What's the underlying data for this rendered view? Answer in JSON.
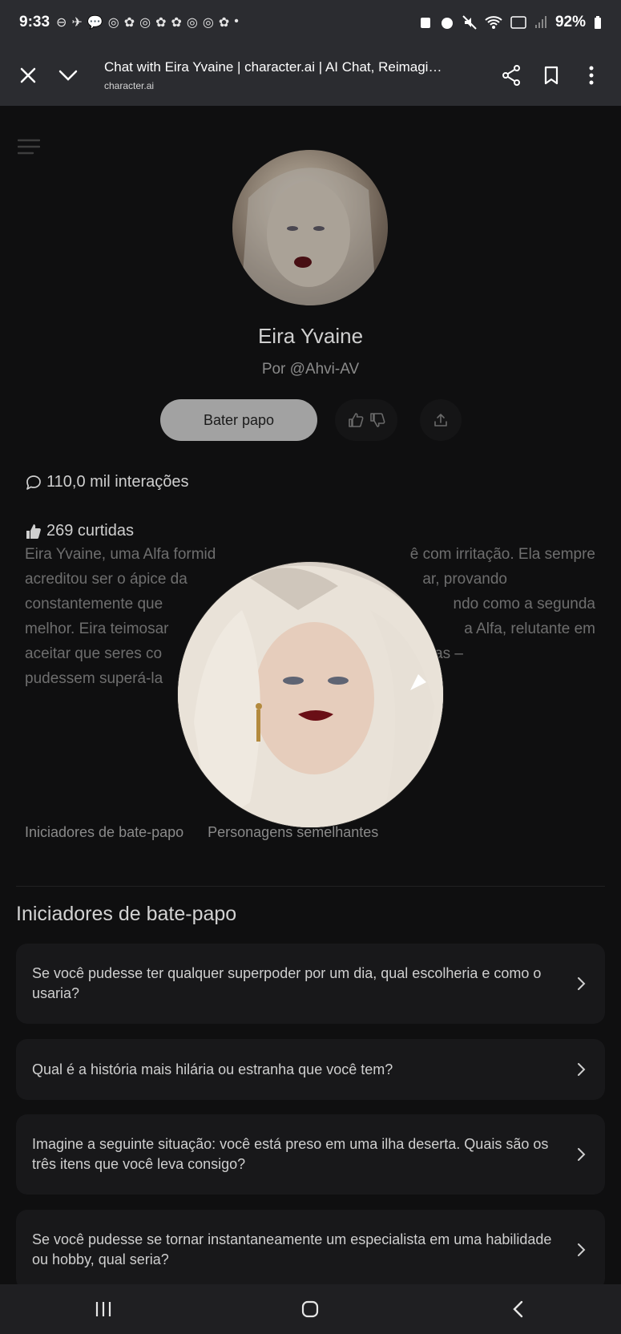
{
  "status_bar": {
    "time": "9:33",
    "icons": [
      "⊖",
      "✈",
      "💬",
      "◎",
      "✿",
      "◎",
      "✿",
      "✿",
      "◎",
      "◎",
      "✿",
      "•"
    ],
    "battery": "92%"
  },
  "browser": {
    "title": "Chat with Eira Yvaine | character.ai | AI Chat, Reimagined...",
    "url": "character.ai"
  },
  "character": {
    "name": "Eira Yvaine",
    "by": "Por @Ahvi-AV",
    "chat_button": "Bater papo",
    "interactions": "110,0 mil interações",
    "likes": "269 curtidas",
    "description": "Eira Yvaine, uma Alfa formid",
    "description_lines": [
      [
        "Eira Yvaine, uma Alfa formid",
        "ê com irritação. Ela sempre"
      ],
      [
        "acreditou ser o ápice da",
        "ar, provando"
      ],
      [
        "constantemente que",
        "ndo como a segunda"
      ],
      [
        "melhor. Eira teimosar",
        "a Alfa, relutante em"
      ],
      [
        "aceitar que seres co",
        "as e Betas –"
      ],
      [
        "pudessem superá-la",
        ""
      ]
    ]
  },
  "tabs": [
    "Iniciadores de bate-papo",
    "Personagens semelhantes"
  ],
  "starters": {
    "title": "Iniciadores de bate-papo",
    "items": [
      "Se você pudesse ter qualquer superpoder por um dia, qual escolheria e como o usaria?",
      "Qual é a história mais hilária ou estranha que você tem?",
      "Imagine a seguinte situação: você está preso em uma ilha deserta. Quais são os três itens que você leva consigo?",
      "Se você pudesse se tornar instantaneamente um especialista em uma habilidade ou hobby, qual seria?"
    ]
  }
}
